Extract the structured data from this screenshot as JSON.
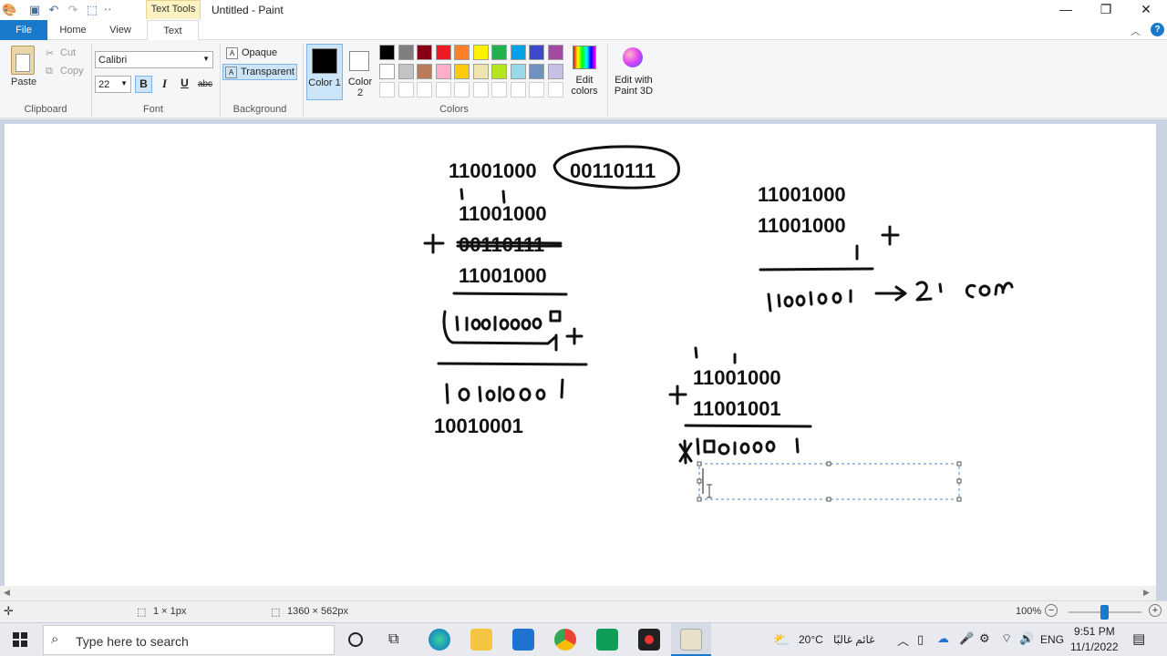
{
  "window": {
    "title": "Untitled - Paint",
    "context_tab": "Text Tools"
  },
  "tabs": [
    "File",
    "Home",
    "View",
    "Text"
  ],
  "clipboard": {
    "paste": "Paste",
    "cut": "Cut",
    "copy": "Copy",
    "group": "Clipboard"
  },
  "font": {
    "family": "Calibri",
    "size": "22",
    "bold": "B",
    "italic": "I",
    "underline": "U",
    "strike": "abc",
    "group": "Font"
  },
  "background": {
    "opaque": "Opaque",
    "transparent": "Transparent",
    "group": "Background"
  },
  "colors": {
    "color1_label": "Color 1",
    "color2_label": "Color 2",
    "edit_colors": "Edit colors",
    "paint3d": "Edit with Paint 3D",
    "group": "Colors",
    "palette_row1": [
      "#000000",
      "#7f7f7f",
      "#880015",
      "#ed1c24",
      "#ff7f27",
      "#fff200",
      "#22b14c",
      "#00a2e8",
      "#3f48cc",
      "#a349a4"
    ],
    "palette_row2": [
      "#ffffff",
      "#c3c3c3",
      "#b97a57",
      "#ffaec9",
      "#ffc90e",
      "#efe4b0",
      "#b5e61d",
      "#99d9ea",
      "#7092be",
      "#c8bfe7"
    ]
  },
  "canvas_text": {
    "t1": "11001000",
    "t2": "00110111",
    "t3": "11001000",
    "t4": "00110111",
    "t5": "11001000",
    "t6": "10010001",
    "t7": "11001000",
    "t8": "11001000",
    "t9": "11001000",
    "t10": "11001001"
  },
  "status": {
    "selection": "1 × 1px",
    "size": "1360 × 562px",
    "zoom": "100%"
  },
  "taskbar": {
    "search_placeholder": "Type here to search",
    "weather": "20°C",
    "weather_text": "غائم غالبًا",
    "lang": "ENG",
    "time": "9:51 PM",
    "date": "11/1/2022"
  }
}
